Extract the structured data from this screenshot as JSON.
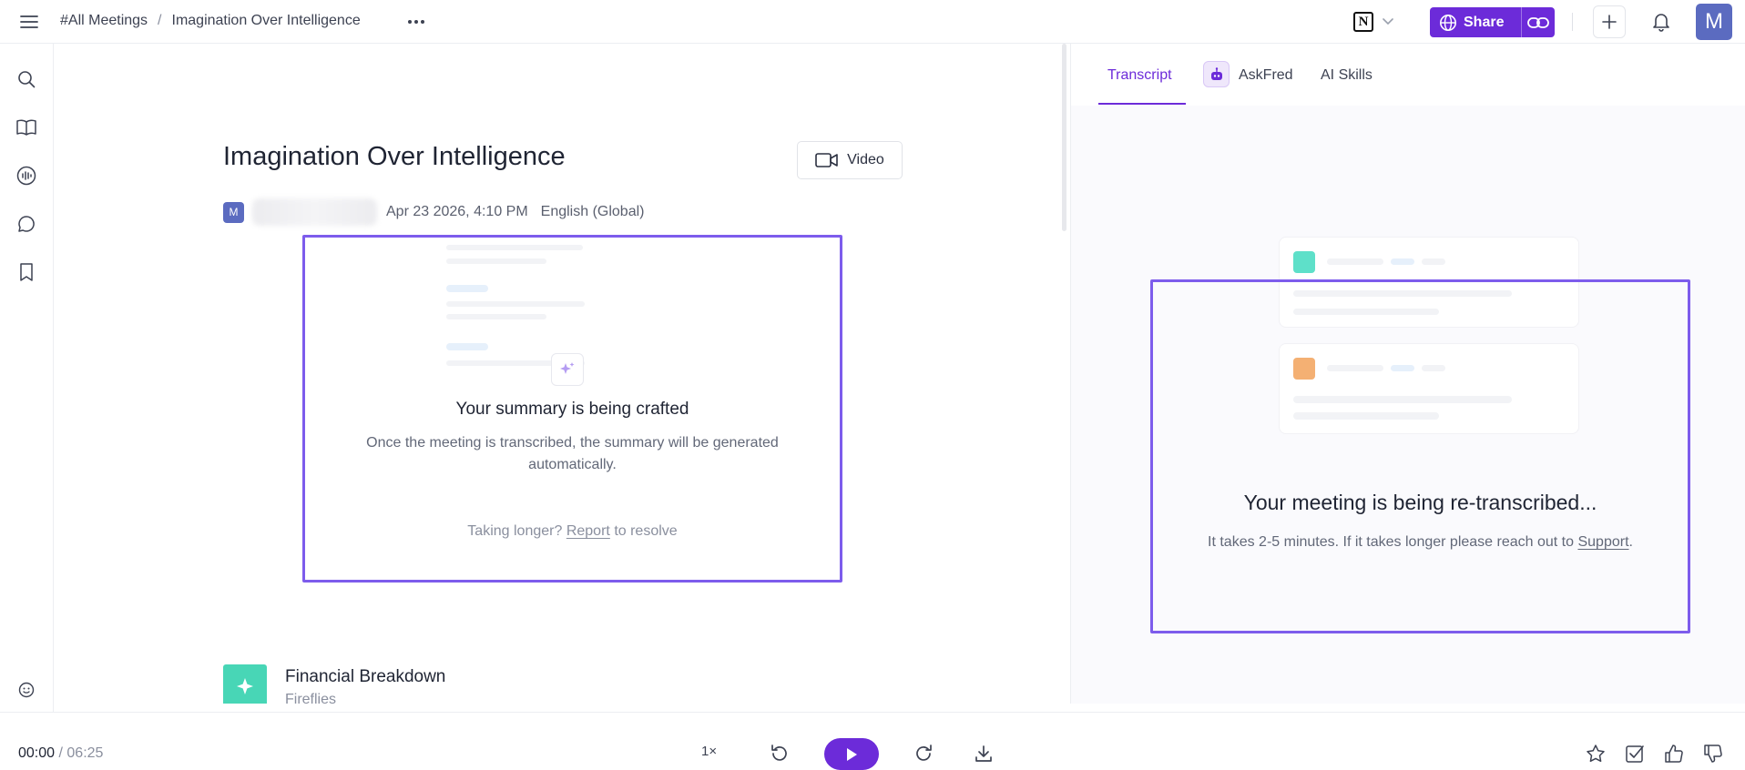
{
  "header": {
    "breadcrumb_root": "#All Meetings",
    "breadcrumb_separator": "/",
    "breadcrumb_current": "Imagination Over Intelligence",
    "share_label": "Share",
    "notion_letter": "N",
    "user_initial": "M",
    "icons": [
      "hamburger-menu-icon",
      "more-horizontal-icon",
      "notion-logo-icon",
      "chevron-down-icon",
      "globe-icon",
      "link-icon",
      "plus-icon",
      "bell-icon"
    ]
  },
  "sidebar": {
    "icons": [
      "search-icon",
      "book-icon",
      "audio-wave-icon",
      "chat-bubble-icon",
      "bookmark-icon",
      "smiley-icon"
    ]
  },
  "meeting": {
    "title": "Imagination Over Intelligence",
    "video_label": "Video",
    "owner_initial": "M",
    "datetime": "Apr 23 2026, 4:10 PM",
    "language": "English (Global)"
  },
  "summary": {
    "title": "Your summary is being crafted",
    "description": "Once the meeting is transcribed, the summary will be generated automatically.",
    "footer_prefix": "Taking longer?",
    "footer_link": "Report",
    "footer_suffix": "to resolve"
  },
  "skill": {
    "name": "Financial Breakdown",
    "source": "Fireflies"
  },
  "right_panel": {
    "tabs": [
      {
        "label": "Transcript",
        "active": true
      },
      {
        "label": "AskFred",
        "active": false
      },
      {
        "label": "AI Skills",
        "active": false
      }
    ],
    "status_title": "Your meeting is being re-transcribed...",
    "status_desc_prefix": "It takes 2-5 minutes. If it takes longer please reach out to",
    "status_link": "Support",
    "status_desc_suffix": "."
  },
  "player": {
    "current_time": "00:00",
    "separator": "/",
    "duration": "06:25",
    "speed": "1×",
    "icons": [
      "rewind-icon",
      "play-icon",
      "forward-icon",
      "download-icon",
      "star-icon",
      "checkbox-icon",
      "thumbs-up-icon",
      "thumbs-down-icon"
    ]
  },
  "colors": {
    "brand_purple": "#6c2bd9",
    "highlight_border": "#7d5cec",
    "avatar_blue": "#5b6bc0",
    "skill_teal": "#48d6b6",
    "ghost_teal": "#5ee0c9",
    "ghost_orange": "#f4b073"
  }
}
